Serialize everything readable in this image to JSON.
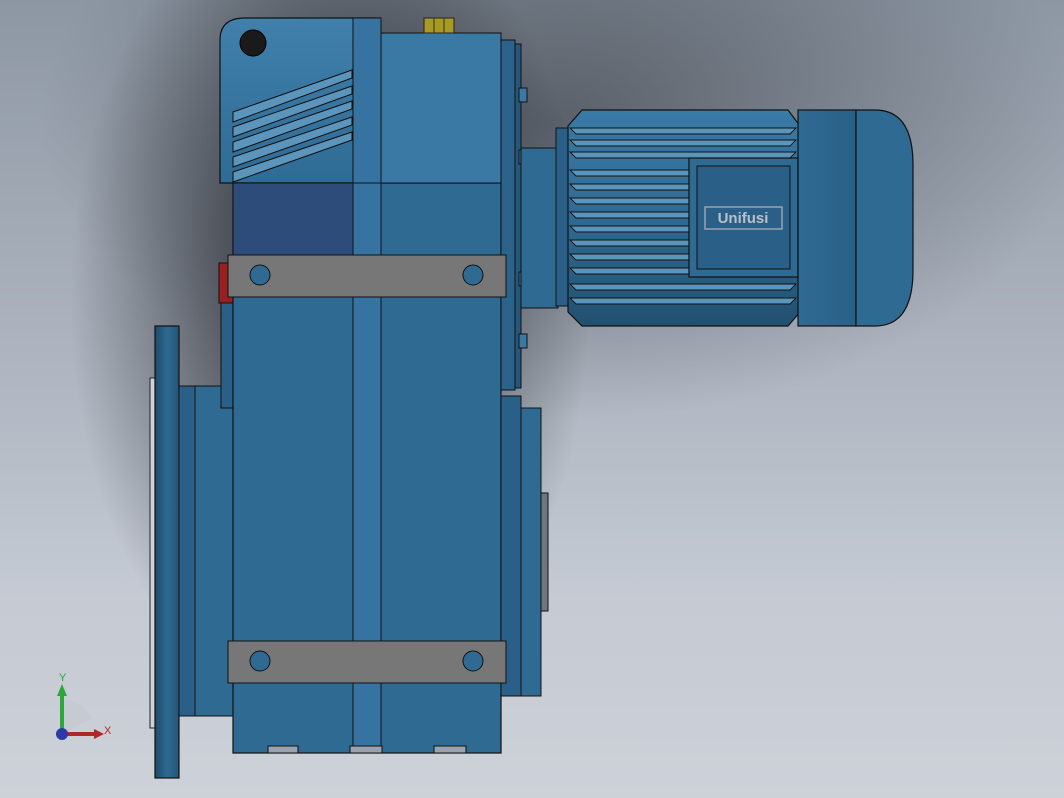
{
  "viewport": {
    "background_top": "#8d97a3",
    "background_bottom": "#cdd1d8"
  },
  "model": {
    "body_color": "#2f6a93",
    "body_dark": "#23506f",
    "body_light": "#4a86ad",
    "strap_color": "#777777",
    "panel_color": "#2d4c7a",
    "red_accent": "#9a2020",
    "vent_plug_color": "#a79a22",
    "nameplate": {
      "logo_text": "Unifusi"
    }
  },
  "triad": {
    "y_label": "Y",
    "x_label": "X",
    "y_color": "#2ea63a",
    "x_color": "#b2262a",
    "z_color": "#2b3aa8"
  }
}
